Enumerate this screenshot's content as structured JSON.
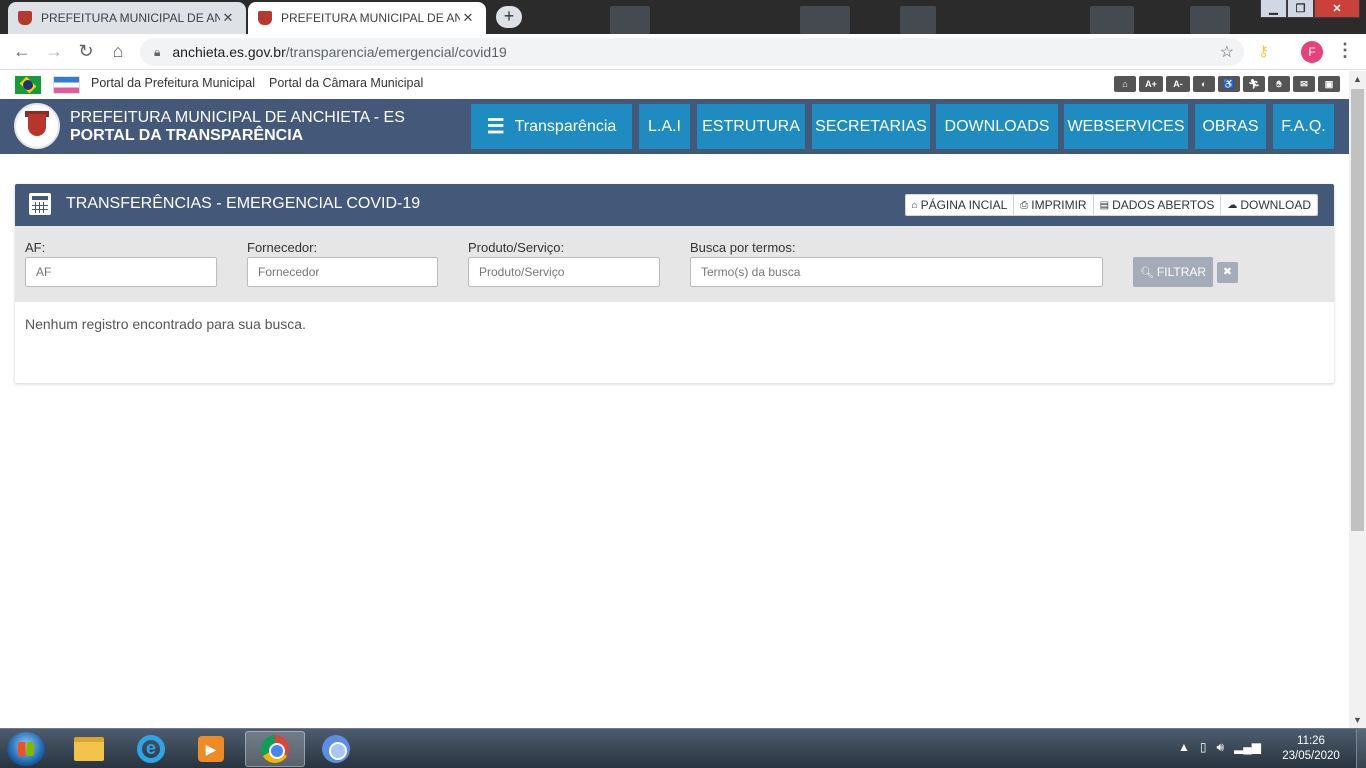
{
  "browser": {
    "tabs": [
      {
        "title": "PREFEITURA MUNICIPAL DE ANCHIETA - ES",
        "active": false
      },
      {
        "title": "PREFEITURA MUNICIPAL DE ANCHIETA - ES",
        "active": true
      }
    ],
    "new_tab": "+",
    "close_glyph": "✕",
    "url_host": "anchieta.es.gov.br",
    "url_path": "/transparencia/emergencial/covid19",
    "profile_initial": "F"
  },
  "topstrip": {
    "link_prefeitura": "Portal da Prefeitura Municipal",
    "link_camara": "Portal da Câmara Municipal",
    "accessibility_icons": [
      "home-icon",
      "increase-font-icon",
      "decrease-font-icon",
      "contrast-icon",
      "wheelchair-icon",
      "running-icon",
      "sign-language-icon",
      "email-icon",
      "lock-icon"
    ]
  },
  "header": {
    "line1": "PREFEITURA MUNICIPAL DE ANCHIETA - ES",
    "line2": "PORTAL DA TRANSPARÊNCIA",
    "nav": [
      "Transparência",
      "L.A.I",
      "ESTRUTURA",
      "SECRETARIAS",
      "DOWNLOADS",
      "WEBSERVICES",
      "OBRAS",
      "F.A.Q."
    ]
  },
  "panel": {
    "title": "TRANSFERÊNCIAS - EMERGENCIAL COVID-19",
    "actions": [
      "PÁGINA INCIAL",
      "IMPRIMIR",
      "DADOS ABERTOS",
      "DOWNLOAD"
    ],
    "filters": {
      "af_label": "AF:",
      "af_placeholder": "AF",
      "fornecedor_label": "Fornecedor:",
      "fornecedor_placeholder": "Fornecedor",
      "produto_label": "Produto/Serviço:",
      "produto_placeholder": "Produto/Serviço",
      "busca_label": "Busca por termos:",
      "busca_placeholder": "Termo(s) da busca",
      "filter_button": "FILTRAR",
      "clear_button": "✖"
    },
    "empty_message": "Nenhum registro encontrado para sua busca."
  },
  "taskbar": {
    "time": "11:26",
    "date": "23/05/2020"
  },
  "colors": {
    "header_bg": "#44597a",
    "nav_item_bg": "#1e8cc0",
    "filter_button_bg": "#a3acb8"
  }
}
